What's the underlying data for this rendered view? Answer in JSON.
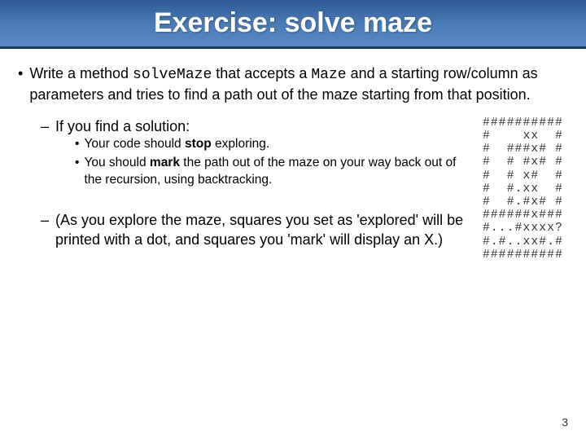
{
  "title": "Exercise: solve maze",
  "bullet1": {
    "pre": "Write a method ",
    "code1": "solveMaze",
    "mid1": " that accepts a ",
    "code2": "Maze",
    "post": " and a starting row/column as parameters and tries to find a path out of the maze starting from that position."
  },
  "sub1": "If you find a solution:",
  "subsub1": {
    "pre": "Your code should ",
    "bold": "stop",
    "post": " exploring."
  },
  "subsub2": {
    "pre": "You should ",
    "bold": "mark",
    "post": " the path out of the maze on your way back out of the recursion, using backtracking."
  },
  "sub2": "(As you explore the maze, squares you set as 'explored' will be printed with a dot, and squares you 'mark' will display an X.)",
  "maze": "##########\n#    xx  #\n#  ###x# #\n#  # #x# #\n#  # x#  #\n#  #.xx  #\n#  #.#x# #\n######x###\n#...#xxxx?\n#.#..xx#.#\n##########",
  "page": "3"
}
